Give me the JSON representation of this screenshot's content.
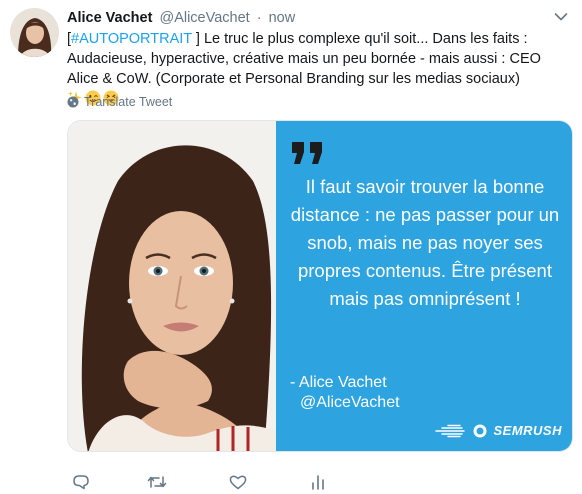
{
  "tweet": {
    "author_name": "Alice Vachet",
    "author_handle": "@AliceVachet",
    "separator": "·",
    "timestamp": "now",
    "text_hashtag_open": "[",
    "text_hashtag": "#AUTOPORTRAIT",
    "text_body": " ] Le truc le plus complexe qu'il soit... Dans les faits : Audacieuse, hyperactive, créative mais un peu bornée - mais aussi : CEO Alice & CoW. (Corporate et Personal Branding sur les medias sociaux) ",
    "emojis": [
      "sparkles-emoji",
      "winking-face-emoji",
      "squinting-tongue-face-emoji"
    ],
    "translate_label": "Translate Tweet"
  },
  "media": {
    "quote_text": "Il faut savoir trouver la bonne distance : ne pas passer pour un snob, mais ne pas noyer ses propres contenus. Être présent mais pas omniprésent !",
    "quote_author": "- Alice Vachet",
    "quote_handle": "@AliceVachet",
    "brand_name": "SEMRUSH",
    "panel_color": "#2da3e0"
  },
  "actions": {
    "icons": [
      "reply-icon",
      "retweet-icon",
      "like-icon",
      "analytics-icon"
    ]
  },
  "colors": {
    "link": "#1da1f2",
    "secondary_text": "#657786",
    "primary_text": "#14171a"
  }
}
